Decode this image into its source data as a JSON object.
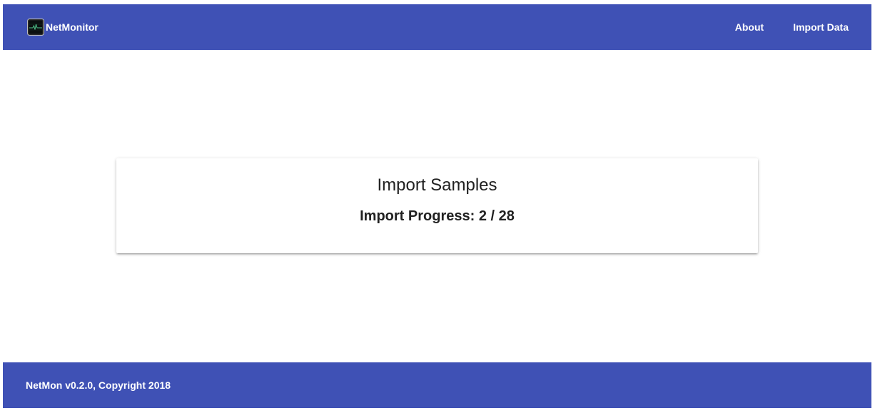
{
  "navbar": {
    "brand_name": "NetMonitor",
    "brand_icon": "activity-monitor-icon",
    "links": [
      {
        "label": "About"
      },
      {
        "label": "Import Data"
      }
    ],
    "color": "#3f51b5"
  },
  "card": {
    "title": "Import Samples",
    "progress_text": "Import Progress: 2 / 28",
    "progress": {
      "current": 2,
      "total": 28
    }
  },
  "footer": {
    "text": "NetMon v0.2.0, Copyright 2018"
  }
}
